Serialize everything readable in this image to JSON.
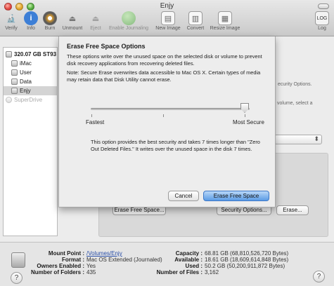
{
  "window": {
    "title": "Enjy"
  },
  "toolbar": {
    "left": [
      {
        "label": "Verify",
        "icon": "microscope-icon"
      },
      {
        "label": "Info",
        "icon": "info-icon"
      },
      {
        "label": "Burn",
        "icon": "burn-icon"
      },
      {
        "label": "Unmount",
        "icon": "unmount-icon"
      },
      {
        "label": "Eject",
        "icon": "eject-icon"
      },
      {
        "label": "Enable Journaling",
        "icon": "journal-icon"
      },
      {
        "label": "New Image",
        "icon": "new-image-icon"
      },
      {
        "label": "Convert",
        "icon": "convert-icon"
      },
      {
        "label": "Resize Image",
        "icon": "resize-image-icon"
      }
    ],
    "right": {
      "label": "Log",
      "icon": "log-icon"
    }
  },
  "sidebar": {
    "disk": "320.07 GB ST93",
    "volumes": [
      "iMac",
      "User",
      "Data",
      "Enjy"
    ],
    "selected": "Enjy",
    "drive": "SuperDrive"
  },
  "background_fragments": {
    "security_options_text": "ecurity Options.",
    "volume_text": "volume, select a",
    "erase_free_space_button": "Erase Free Space...",
    "security_options_button": "Security Options...",
    "erase_button": "Erase..."
  },
  "sheet": {
    "title": "Erase Free Space Options",
    "description": "These options write over the unused space on the selected disk or volume to prevent disk recovery applications from recovering deleted files.",
    "note": "Note: Secure Erase overwrites data accessible to Mac OS X.  Certain types of media may retain data that Disk Utility cannot erase.",
    "slider_min_label": "Fastest",
    "slider_max_label": "Most Secure",
    "slider_position": 1.0,
    "option_text": "This option provides the best security and takes 7 times longer than \"Zero Out Deleted Files.\" It writes over the unused space in the disk 7 times.",
    "cancel_label": "Cancel",
    "confirm_label": "Erase Free Space"
  },
  "status": {
    "mount_point_label": "Mount Point :",
    "mount_point_value": "/Volumes/Enjy",
    "format_label": "Format :",
    "format_value": "Mac OS Extended (Journaled)",
    "owners_label": "Owners Enabled :",
    "owners_value": "Yes",
    "folders_label": "Number of Folders :",
    "folders_value": "435",
    "capacity_label": "Capacity :",
    "capacity_value": "68.81 GB (68,810,526,720 Bytes)",
    "available_label": "Available :",
    "available_value": "18.61 GB (18,609,614,848 Bytes)",
    "used_label": "Used :",
    "used_value": "50.2 GB (50,200,911,872 Bytes)",
    "files_label": "Number of Files :",
    "files_value": "3,162"
  }
}
